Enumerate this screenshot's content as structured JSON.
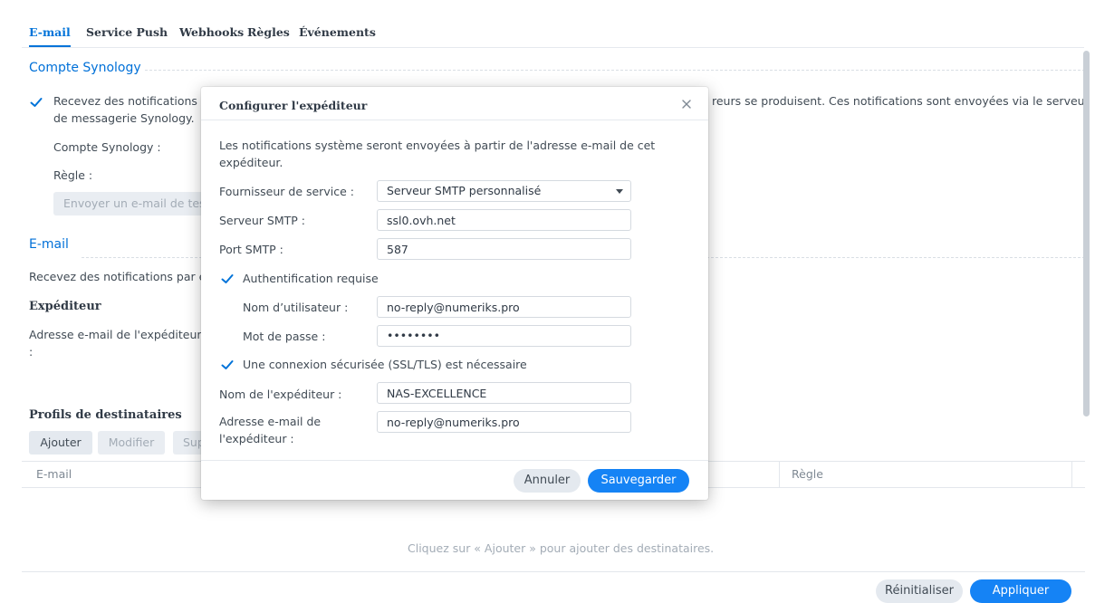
{
  "tabs": [
    {
      "label": "E-mail",
      "active": true
    },
    {
      "label": "Service Push",
      "active": false
    },
    {
      "label": "Webhooks",
      "active": false
    },
    {
      "label": "Règles",
      "active": false
    },
    {
      "label": "Événements",
      "active": false
    }
  ],
  "synology": {
    "title": "Compte Synology",
    "checkbox_text_line1": "Recevez des notifications d",
    "checkbox_text_right": "reurs se produisent. Ces notifications sont envoyées via le serveur",
    "checkbox_text_line2": "de messagerie Synology.",
    "account_label": "Compte Synology :",
    "rule_label": "Règle :",
    "test_button": "Envoyer un e-mail de tes"
  },
  "email": {
    "title": "E-mail",
    "desc": "Recevez des notifications par e",
    "sender_heading": "Expéditeur",
    "sender_address_label": "Adresse e-mail de l'expéditeur",
    "sender_address_colon": ":",
    "recipients_heading": "Profils de destinataires",
    "add_button": "Ajouter",
    "edit_button": "Modifier",
    "delete_button": "Sup",
    "col_email": "E-mail",
    "col_rule": "Règle",
    "empty_hint": "Cliquez sur « Ajouter » pour ajouter des destinataires."
  },
  "footer": {
    "reset_button": "Réinitialiser",
    "apply_button": "Appliquer"
  },
  "dialog": {
    "title": "Configurer l'expéditeur",
    "intro_line1": "Les notifications système seront envoyées à partir de l'adresse e-mail de cet",
    "intro_line2": "expéditeur.",
    "provider_label": "Fournisseur de service :",
    "provider_value": "Serveur SMTP personnalisé",
    "smtp_server_label": "Serveur SMTP :",
    "smtp_server_value": "ssl0.ovh.net",
    "smtp_port_label": "Port SMTP :",
    "smtp_port_value": "587",
    "auth_label": "Authentification requise",
    "username_label": "Nom d’utilisateur :",
    "username_value": "no-reply@numeriks.pro",
    "password_label": "Mot de passe :",
    "password_value": "••••••••",
    "ssl_label": "Une connexion sécurisée (SSL/TLS) est nécessaire",
    "sender_name_label": "Nom de l'expéditeur :",
    "sender_name_value": "NAS-EXCELLENCE",
    "sender_email_label_line1": "Adresse e-mail de",
    "sender_email_label_line2": "l'expéditeur :",
    "sender_email_value": "no-reply@numeriks.pro",
    "cancel_button": "Annuler",
    "save_button": "Sauvegarder"
  },
  "colors": {
    "accent": "#0070d8",
    "primary_button": "#1583f5"
  }
}
